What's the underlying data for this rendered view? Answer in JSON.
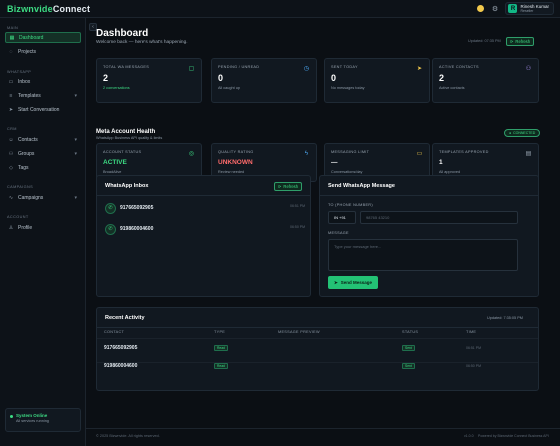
{
  "app": {
    "logo_part1": "Bizwnvide",
    "logo_part2": "Connect"
  },
  "user": {
    "name": "Rinesh Kumar",
    "role": "Reseller",
    "initial": "R"
  },
  "sidebar": {
    "sections": [
      {
        "label": "MAIN"
      },
      {
        "label": "WHATSAPP"
      },
      {
        "label": "CRM"
      },
      {
        "label": "CAMPAIGNS"
      },
      {
        "label": "ACCOUNT"
      }
    ],
    "items": [
      {
        "label": "Dashboard",
        "icon": "grid-icon"
      },
      {
        "label": "Projects",
        "icon": "folder-icon"
      },
      {
        "label": "Inbox",
        "icon": "inbox-icon"
      },
      {
        "label": "Templates",
        "icon": "template-icon"
      },
      {
        "label": "Start Conversation",
        "icon": "send-icon"
      },
      {
        "label": "Contacts",
        "icon": "contacts-icon"
      },
      {
        "label": "Groups",
        "icon": "groups-icon"
      },
      {
        "label": "Tags",
        "icon": "tag-icon"
      },
      {
        "label": "Campaigns",
        "icon": "wave-icon"
      },
      {
        "label": "Profile",
        "icon": "user-icon"
      }
    ],
    "system_title": "System Online",
    "system_sub": "All services running"
  },
  "header": {
    "title": "Dashboard",
    "subtitle": "Welcome back — here's what's happening.",
    "updated": "Updated: 07:35 PM",
    "refresh_label": "Refresh"
  },
  "stats": [
    {
      "label": "TOTAL WA MESSAGES",
      "value": "2",
      "sub": "2 conversations",
      "icon": "chat-icon",
      "color": "#3ddc84"
    },
    {
      "label": "PENDING / UNREAD",
      "value": "0",
      "sub": "All caught up",
      "icon": "clock-icon",
      "color": "#4dabf7"
    },
    {
      "label": "SENT TODAY",
      "value": "0",
      "sub": "No messages today",
      "icon": "send-icon",
      "color": "#f2c94c"
    },
    {
      "label": "ACTIVE CONTACTS",
      "value": "2",
      "sub": "Active contacts",
      "icon": "people-icon",
      "color": "#b197fc"
    }
  ],
  "health": {
    "title": "Meta Account Health",
    "subtitle": "WhatsApp Business API quality & limits",
    "connected": "CONNECTED",
    "cards": [
      {
        "label": "ACCOUNT STATUS",
        "value": "ACTIVE",
        "sub": "BroadAlive",
        "icon": "check-icon",
        "color": "#3ddc84"
      },
      {
        "label": "QUALITY RATING",
        "value": "UNKNOWN",
        "sub": "Review needed",
        "icon": "bolt-icon",
        "color": "#ff6b6b"
      },
      {
        "label": "MESSAGING LIMIT",
        "value": "—",
        "sub": "Conversations/day",
        "icon": "message-icon",
        "color": "#f2c94c"
      },
      {
        "label": "TEMPLATES APPROVED",
        "value": "1",
        "sub": "All approved",
        "icon": "doc-icon",
        "color": "#e6edf3"
      }
    ]
  },
  "inbox": {
    "title": "WhatsApp Inbox",
    "refresh_label": "Refresh",
    "items": [
      {
        "number": "917665092905",
        "time": "06:51 PM"
      },
      {
        "number": "919860004600",
        "time": "06:50 PM"
      }
    ]
  },
  "send": {
    "title": "Send WhatsApp Message",
    "to_label": "TO (PHONE NUMBER)",
    "country_code": "IN +91",
    "phone_placeholder": "98765 43210",
    "message_label": "MESSAGE",
    "message_placeholder": "Type your message here...",
    "send_label": "Send Message"
  },
  "activity": {
    "title": "Recent Activity",
    "updated": "Updated: 7:35:05 PM",
    "columns": [
      "CONTACT",
      "TYPE",
      "MESSAGE PREVIEW",
      "STATUS",
      "TIME"
    ],
    "rows": [
      {
        "contact": "917665092905",
        "type": "Read",
        "preview": "",
        "status": "Sent",
        "time": "06:51 PM"
      },
      {
        "contact": "919860004600",
        "type": "Read",
        "preview": "",
        "status": "Sent",
        "time": "06:50 PM"
      }
    ]
  },
  "footer": {
    "left": "© 2025 Bizwnvide. All rights reserved.",
    "right": "Powered by Bizwnvide Connect Business API",
    "version": "v1.0.0"
  }
}
